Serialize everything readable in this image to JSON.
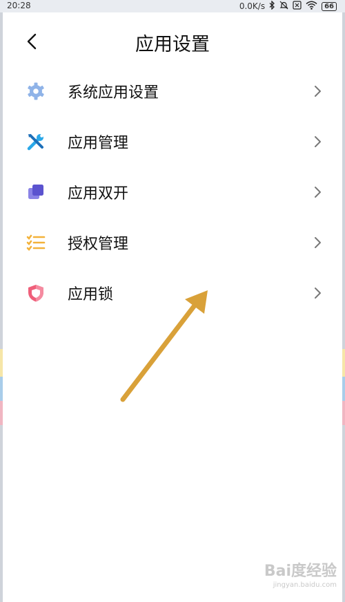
{
  "status_bar": {
    "time": "20:28",
    "net_speed": "0.0K/s",
    "battery": "66"
  },
  "header": {
    "title": "应用设置"
  },
  "menu": {
    "items": [
      {
        "label": "系统应用设置",
        "icon": "gear-icon",
        "color": "#8fb3e8"
      },
      {
        "label": "应用管理",
        "icon": "tools-icon",
        "color": "#2aa8e8"
      },
      {
        "label": "应用双开",
        "icon": "dual-app-icon",
        "color": "#6b63d8"
      },
      {
        "label": "授权管理",
        "icon": "checklist-icon",
        "color": "#f3b23a"
      },
      {
        "label": "应用锁",
        "icon": "shield-icon",
        "color": "#ef5f7a"
      }
    ]
  },
  "annotation": {
    "arrow_color": "#d9a139"
  },
  "watermark": {
    "brand": "Bai度经验",
    "url": "jingyan.baidu.com"
  }
}
